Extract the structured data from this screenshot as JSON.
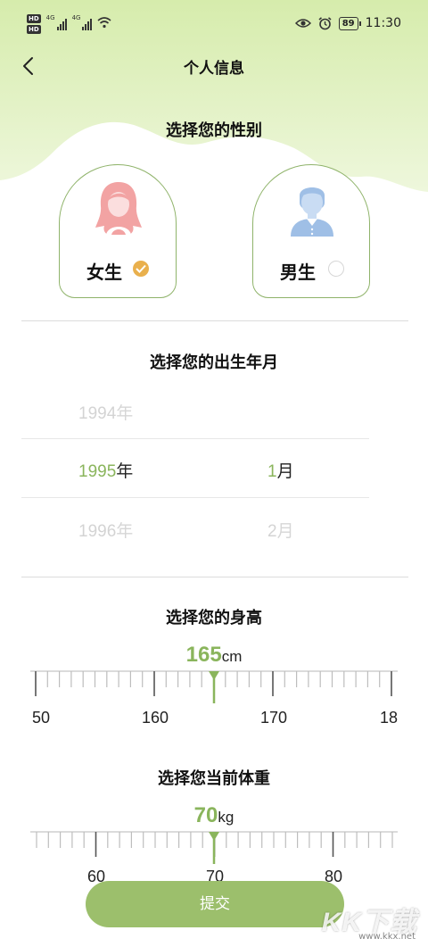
{
  "status_bar": {
    "hd_badge": "HD",
    "net_type": "4G",
    "battery": "89",
    "time": "11:30"
  },
  "header": {
    "title": "个人信息"
  },
  "gender": {
    "title": "选择您的性别",
    "options": [
      {
        "label": "女生",
        "selected": true
      },
      {
        "label": "男生",
        "selected": false
      }
    ]
  },
  "birth": {
    "title": "选择您的出生年月",
    "year_unit": "年",
    "month_unit": "月",
    "years": [
      "1994",
      "1995",
      "1996"
    ],
    "selected_year": "1995",
    "months": [
      "1",
      "2"
    ],
    "selected_month": "1"
  },
  "height": {
    "title": "选择您的身高",
    "value": "165",
    "unit": "cm",
    "tick_labels": [
      "50",
      "160",
      "170",
      "18"
    ]
  },
  "weight": {
    "title": "选择您当前体重",
    "value": "70",
    "unit": "kg",
    "tick_labels": [
      "60",
      "70",
      "80"
    ]
  },
  "submit_label": "提交",
  "colors": {
    "accent": "#8ab55c",
    "button": "#9cbf6c",
    "selected_check": "#e9b04d",
    "female_avatar": "#f2a3a3",
    "male_avatar": "#9fbfe6"
  },
  "watermark": {
    "logo": "KK下载",
    "url": "www.kkx.net"
  }
}
